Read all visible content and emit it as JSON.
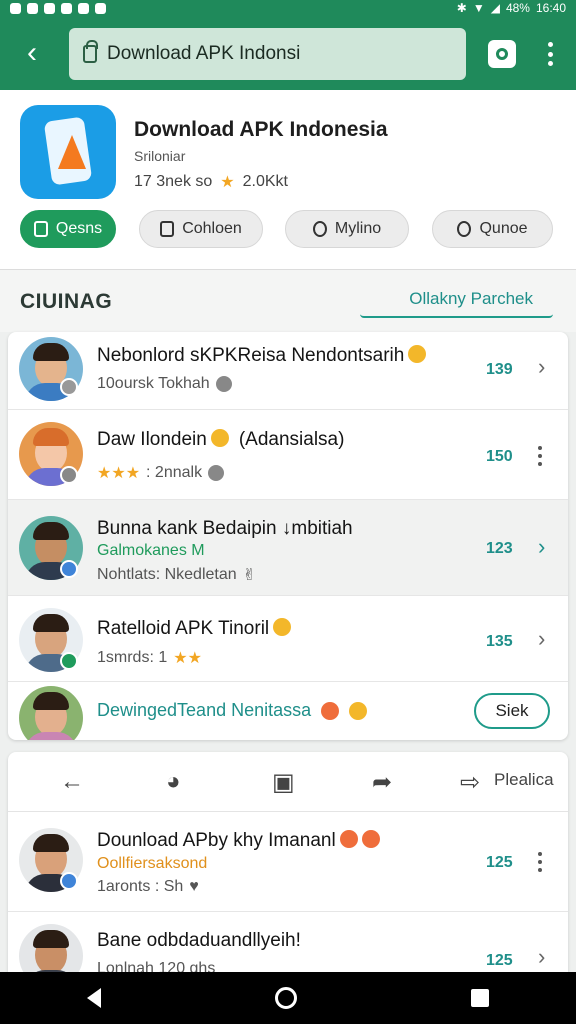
{
  "status_bar": {
    "battery": "48%",
    "time": "16:40"
  },
  "toolbar": {
    "url_text": "Download APK Indonsi"
  },
  "app": {
    "title": "Download APK Indonesia",
    "subtitle": "Sriloniar",
    "meta": "17 3nek so",
    "rating": "2.0Kkt"
  },
  "chips": [
    {
      "label": "Qesns"
    },
    {
      "label": "Cohloen"
    },
    {
      "label": "Mylino"
    },
    {
      "label": "Qunoe"
    }
  ],
  "section": {
    "title": "CIUINAG",
    "link": "Ollakny Parchek"
  },
  "rows": [
    {
      "title": "Nebonlord sKPKReisa Nendontsarih",
      "sub": "10oursk Tokhah",
      "num": "139"
    },
    {
      "title": "Daw Ilondein",
      "title2": "(Adansialsa)",
      "sub": ": 2nnalk",
      "num": "150"
    },
    {
      "title": "Bunna kank Bedaipin ↓mbitiah",
      "sub": "Galmokanes M",
      "sub2": "Nohtlats: Nkedletan",
      "num": "123"
    },
    {
      "title": "Ratelloid APK Tinoril",
      "sub": "1smrds: 1",
      "num": "135"
    },
    {
      "title": "DewingedTeand Nenitassa",
      "button": "Siek"
    }
  ],
  "actions": {
    "label": "Plealica"
  },
  "rows2": [
    {
      "title": "Dounload APby khy Imananl",
      "sub": "Oollfiersaksond",
      "sub2": "1aronts : Sh",
      "num": "125"
    },
    {
      "title": "Bane odbdaduandllyeih!",
      "sub": "Lonlnah 120 ghs",
      "num": "125"
    }
  ]
}
